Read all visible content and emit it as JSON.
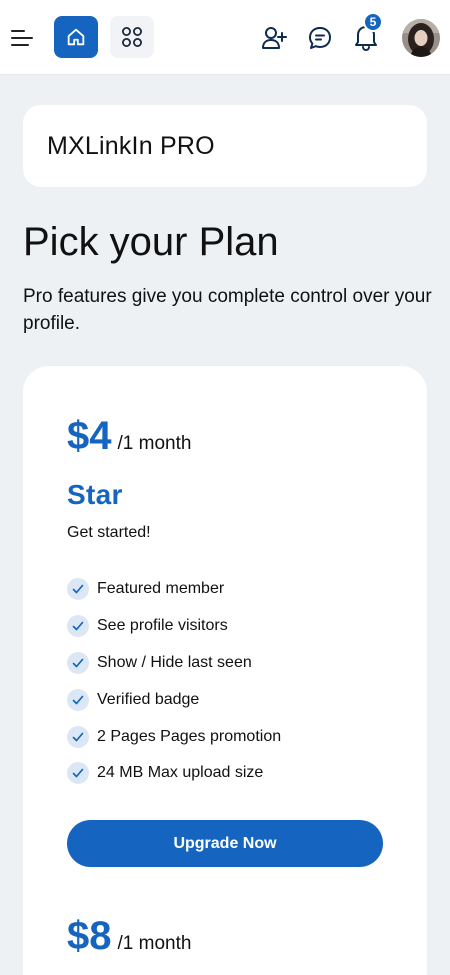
{
  "header": {
    "icons": [
      "menu-icon",
      "home-icon",
      "apps-grid-icon",
      "add-user-icon",
      "chat-icon",
      "bell-icon"
    ],
    "notification_count": "5",
    "accent_color": "#1565c0"
  },
  "brand": {
    "title": "MXLinkIn PRO"
  },
  "page": {
    "title": "Pick your Plan",
    "subtitle": "Pro features give you complete control over your profile."
  },
  "plans": [
    {
      "price": "$4",
      "period": "/1 month",
      "name": "Star",
      "description": "Get started!",
      "features": [
        "Featured member",
        "See profile visitors",
        "Show / Hide last seen",
        "Verified badge",
        "2 Pages Pages promotion",
        "24 MB Max upload size"
      ],
      "button_label": "Upgrade Now"
    },
    {
      "price": "$8",
      "period": "/1 month"
    }
  ]
}
